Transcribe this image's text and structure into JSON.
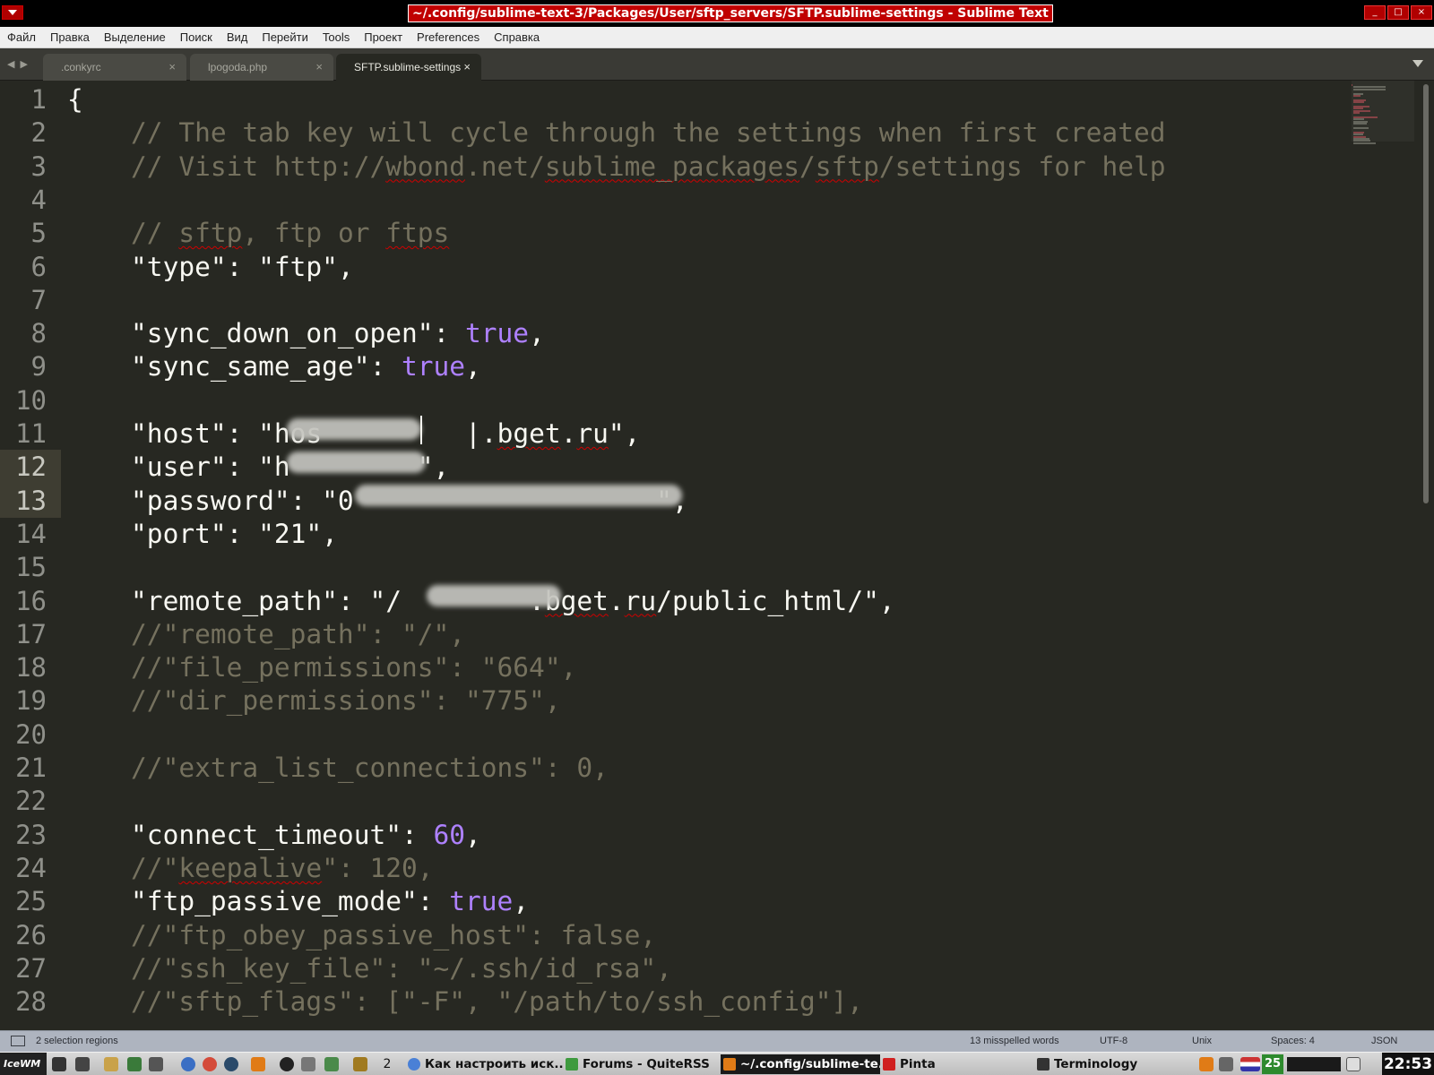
{
  "window": {
    "title": "~/.config/sublime-text-3/Packages/User/sftp_servers/SFTP.sublime-settings - Sublime Text",
    "minimize_glyph": "_",
    "maximize_glyph": "□",
    "close_glyph": "×"
  },
  "menu": [
    "Файл",
    "Правка",
    "Выделение",
    "Поиск",
    "Вид",
    "Перейти",
    "Tools",
    "Проект",
    "Preferences",
    "Справка"
  ],
  "tabs": [
    {
      "label": ".conkyrc",
      "active": false
    },
    {
      "label": "lpogoda.php",
      "active": false
    },
    {
      "label": "SFTP.sublime-settings",
      "active": true
    }
  ],
  "tab_close_glyph": "×",
  "tab_nav": {
    "prev": "◀",
    "next": "▶"
  },
  "editor": {
    "line_numbers": [
      "1",
      "2",
      "3",
      "4",
      "5",
      "6",
      "7",
      "8",
      "9",
      "10",
      "11",
      "12",
      "13",
      "14",
      "15",
      "16",
      "17",
      "18",
      "19",
      "20",
      "21",
      "22",
      "23",
      "24",
      "25",
      "26",
      "27",
      "28"
    ],
    "highlighted_lines": [
      "12",
      "13"
    ],
    "lines": [
      [
        [
          "p",
          "{"
        ]
      ],
      [
        [
          "c",
          "    // The tab key will cycle through the settings when first created"
        ]
      ],
      [
        [
          "c",
          "    // Visit http://"
        ],
        [
          "c sq",
          "wbond"
        ],
        [
          "c",
          ".net/"
        ],
        [
          "c sq",
          "sublime_packages"
        ],
        [
          "c",
          "/"
        ],
        [
          "c sq",
          "sftp"
        ],
        [
          "c",
          "/settings for help"
        ]
      ],
      [],
      [
        [
          "c",
          "    // "
        ],
        [
          "c sq",
          "sftp"
        ],
        [
          "c",
          ", ftp or "
        ],
        [
          "c sq",
          "ftps"
        ]
      ],
      [
        [
          "p",
          "    \"type\": \"ftp\","
        ]
      ],
      [],
      [
        [
          "p",
          "    \"sync_down_on_open\": "
        ],
        [
          "k",
          "true"
        ],
        [
          "p",
          ","
        ]
      ],
      [
        [
          "p",
          "    \"sync_same_age\": "
        ],
        [
          "k",
          "true"
        ],
        [
          "p",
          ","
        ]
      ],
      [],
      [
        [
          "p",
          "    \"host\": \"hos"
        ],
        [
          "p",
          "         "
        ],
        [
          "p",
          "|."
        ],
        [
          "p sq",
          "bget"
        ],
        [
          "p",
          "."
        ],
        [
          "p sq",
          "ru"
        ],
        [
          "p",
          "\","
        ]
      ],
      [
        [
          "p",
          "    \"user\": \"h"
        ],
        [
          "p",
          "        "
        ],
        [
          "p",
          "\","
        ]
      ],
      [
        [
          "p",
          "    \"password\": \"0"
        ],
        [
          "p",
          "                   "
        ],
        [
          "p",
          "\","
        ]
      ],
      [
        [
          "p",
          "    \"port\": \"21\","
        ]
      ],
      [],
      [
        [
          "p",
          "    \"remote_path\": \"/"
        ],
        [
          "p",
          "        "
        ],
        [
          "p",
          "."
        ],
        [
          "p sq",
          "bget"
        ],
        [
          "p",
          "."
        ],
        [
          "p sq",
          "ru"
        ],
        [
          "p",
          "/public_html/\","
        ]
      ],
      [
        [
          "c",
          "    //\"remote_path\": \"/\","
        ]
      ],
      [
        [
          "c",
          "    //\"file_permissions\": \"664\","
        ]
      ],
      [
        [
          "c",
          "    //\"dir_permissions\": \"775\","
        ]
      ],
      [],
      [
        [
          "c",
          "    //\"extra_list_connections\": 0,"
        ]
      ],
      [],
      [
        [
          "p",
          "    \"connect_timeout\": "
        ],
        [
          "k",
          "60"
        ],
        [
          "p",
          ","
        ]
      ],
      [
        [
          "c",
          "    //\""
        ],
        [
          "c sq",
          "keepalive"
        ],
        [
          "c",
          "\": 120,"
        ]
      ],
      [
        [
          "p",
          "    \"ftp_passive_mode\": "
        ],
        [
          "k",
          "true"
        ],
        [
          "p",
          ","
        ]
      ],
      [
        [
          "c",
          "    //\"ftp_obey_passive_host\": false,"
        ]
      ],
      [
        [
          "c",
          "    //\"ssh_key_file\": \"~/.ssh/id_rsa\","
        ]
      ],
      [
        [
          "c",
          "    //\"sftp_flags\": [\"-F\", \"/path/to/ssh_config\"],"
        ]
      ]
    ]
  },
  "status": {
    "selection": "2 selection regions",
    "spelling": "13 misspelled words",
    "encoding": "UTF-8",
    "line_endings": "Unix",
    "indent": "Spaces: 4",
    "syntax": "JSON"
  },
  "taskbar": {
    "start": "IceWM",
    "workspace": "2",
    "tasks": [
      {
        "label": "Как настроить иск...",
        "icon": "chromium-icon",
        "active": false
      },
      {
        "label": "Forums - QuiteRSS",
        "icon": "rss-icon",
        "active": false
      },
      {
        "label": "~/.config/sublime-te...",
        "icon": "sublime-icon",
        "active": true
      },
      {
        "label": "Pinta",
        "icon": "pinta-icon",
        "active": false
      },
      {
        "label": "Terminology",
        "icon": "terminal-icon",
        "active": false
      }
    ],
    "tray_badge": "25",
    "clock": "22:53"
  },
  "colors": {
    "background": "#272822",
    "comment": "#75715e",
    "constant": "#ae81ff",
    "text": "#f8f8f2",
    "titlebar_accent": "#c00000",
    "misspell": "#d00000"
  }
}
